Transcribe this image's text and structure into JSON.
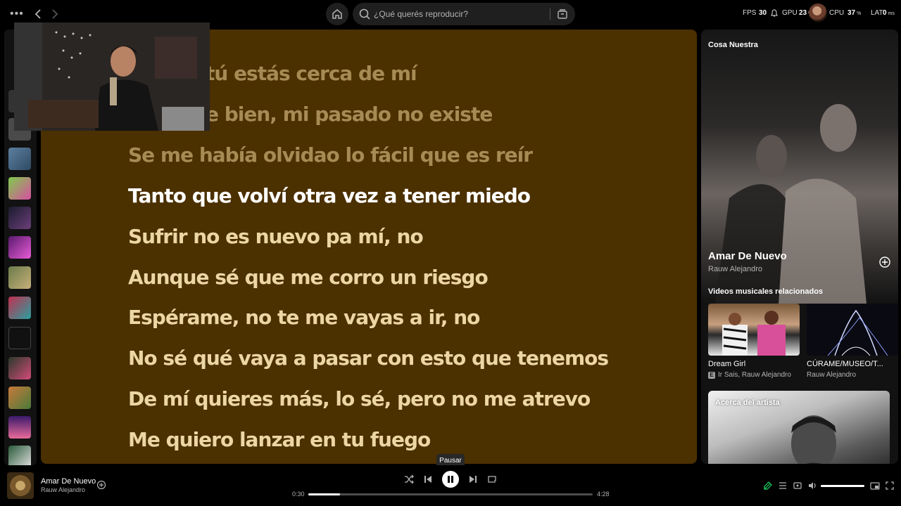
{
  "topbar": {
    "more_icon": "dots-horizontal",
    "search_placeholder": "¿Qué querés reproducir?",
    "stats": {
      "fps_label": "FPS",
      "fps_value": "30",
      "gpu_label": "GPU",
      "gpu_value": "23",
      "cpu_label": "CPU",
      "cpu_value": "37",
      "lat_label": "LAT",
      "lat_value": "0"
    }
  },
  "lyrics": {
    "background": "#4b3000",
    "lines": [
      {
        "text": "tú estás cerca de mí",
        "state": "past"
      },
      {
        "text": "e bien, mi pasado no existe",
        "state": "past"
      },
      {
        "text": "Se me había olvidao lo fácil que es reír",
        "state": "past"
      },
      {
        "text": "Tanto que volví otra vez a tener miedo",
        "state": "current"
      },
      {
        "text": "Sufrir no es nuevo pa mí, no",
        "state": "upcoming"
      },
      {
        "text": "Aunque sé que me corro un riesgo",
        "state": "upcoming"
      },
      {
        "text": "Espérame, no te me vayas a ir, no",
        "state": "upcoming"
      },
      {
        "text": "No sé qué vaya a pasar con esto que tenemos",
        "state": "upcoming"
      },
      {
        "text": "De mí quieres más, lo sé, pero no me atrevo",
        "state": "upcoming"
      },
      {
        "text": "Me quiero lanzar en tu fuego",
        "state": "upcoming"
      }
    ]
  },
  "right_panel": {
    "album": "Cosa Nuestra",
    "song_title": "Amar De Nuevo",
    "song_artist": "Rauw Alejandro",
    "related_title": "Videos musicales relacionados",
    "videos": [
      {
        "title": "Dream Girl",
        "artist": "Ir Sais, Rauw Alejandro",
        "explicit": "E"
      },
      {
        "title": "CÚRAME/MUSEO/T...",
        "artist": "Rauw Alejandro"
      }
    ],
    "about_label": "Acerca del artista"
  },
  "player": {
    "title": "Amar De Nuevo",
    "artist": "Rauw Alejandro",
    "elapsed": "0:30",
    "duration": "4:28",
    "progress": 0.112,
    "tooltip": "Pausar",
    "volume": 1.0
  }
}
